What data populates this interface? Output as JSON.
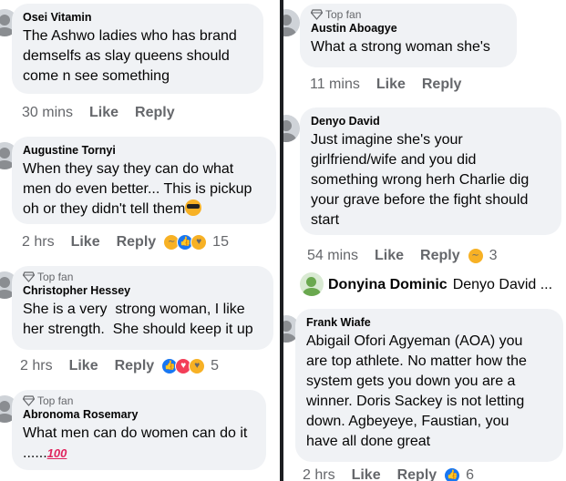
{
  "left": {
    "comments": [
      {
        "author": "Osei Vitamin",
        "text": "The Ashwo ladies who has brand\ndemselfs as slay queens should\ncome n see something",
        "time": "30 mins",
        "like": "Like",
        "reply": "Reply"
      },
      {
        "author": "Augustine Tornyi",
        "text": "When they say they can do what\nmen do even better... This is pickup\noh or they didn't tell them",
        "emoji": "cool-face",
        "time": "2 hrs",
        "like": "Like",
        "reply": "Reply",
        "reactions": [
          "haha",
          "like",
          "care"
        ],
        "count": "15"
      },
      {
        "badge": "Top fan",
        "author": "Christopher Hessey",
        "text": "She is a very  strong woman, I like\nher strength.  She should keep it up",
        "time": "2 hrs",
        "like": "Like",
        "reply": "Reply",
        "reactions": [
          "like",
          "love",
          "care"
        ],
        "count": "5"
      },
      {
        "badge": "Top fan",
        "author": "Abronoma Rosemary",
        "text": "What men can do women can do it\n......",
        "hundred": "100"
      }
    ]
  },
  "right": {
    "comments": [
      {
        "badge": "Top fan",
        "author": "Austin Aboagye",
        "text": "What a strong woman she's",
        "time": "11 mins",
        "like": "Like",
        "reply": "Reply"
      },
      {
        "author": "Denyo David",
        "text": "Just imagine she's your\ngirlfriend/wife and you did\nsomething wrong herh Charlie dig\nyour grave before the fight should\nstart",
        "time": "54 mins",
        "like": "Like",
        "reply": "Reply",
        "reactions": [
          "haha"
        ],
        "count": "3"
      },
      {
        "author": "Frank Wiafe",
        "text": "Abigail Ofori Agyeman (AOA) you\nare top athlete. No matter how the\nsystem gets you down you are a\nwinner. Doris Sackey is not letting\ndown. Agbeyeye, Faustian, you\nhave all done great",
        "time": "2 hrs",
        "like": "Like",
        "reply": "Reply",
        "reactions": [
          "like"
        ],
        "count": "6"
      }
    ],
    "reply_preview": {
      "name": "Donyina Dominic",
      "snippet": "Denyo David ..."
    }
  }
}
